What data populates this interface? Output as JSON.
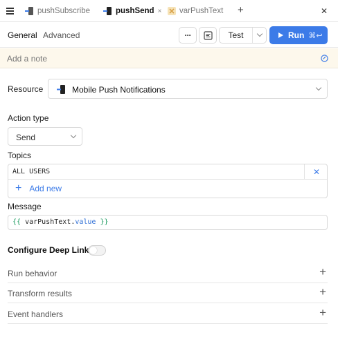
{
  "tabs": [
    {
      "label": "pushSubscribe",
      "icon": "mobile-push-icon",
      "active": false
    },
    {
      "label": "pushSend",
      "icon": "mobile-push-icon",
      "active": true
    },
    {
      "label": "varPushText",
      "icon": "variable-icon",
      "active": false
    }
  ],
  "tab_close_symbol": "×",
  "add_tab_symbol": "+",
  "close_panel_symbol": "✕",
  "subtabs": {
    "general": "General",
    "advanced": "Advanced"
  },
  "toolbar": {
    "more_symbol": "···",
    "test_label": "Test",
    "run_label": "Run",
    "run_shortcut": "⌘↩"
  },
  "note": {
    "placeholder": "Add a note"
  },
  "form": {
    "resource_label": "Resource",
    "resource_value": "Mobile Push Notifications",
    "action_type_label": "Action type",
    "action_type_value": "Send",
    "topics_label": "Topics",
    "topics": [
      "ALL USERS"
    ],
    "topic_remove_symbol": "✕",
    "add_new_label": "Add new",
    "add_new_symbol": "+",
    "message_label": "Message",
    "message_tokens": {
      "open": "{{",
      "var": "varPushText",
      "dot": ".",
      "prop": "value",
      "close": "}}"
    },
    "deep_link_label": "Configure Deep Link",
    "deep_link_enabled": false
  },
  "sections": [
    {
      "label": "Run behavior",
      "symbol": "+"
    },
    {
      "label": "Transform results",
      "symbol": "+"
    },
    {
      "label": "Event handlers",
      "symbol": "+"
    }
  ],
  "colors": {
    "accent": "#3c7be8",
    "note_bg": "#fdf8ec",
    "template_brace": "#1a9a5e"
  }
}
